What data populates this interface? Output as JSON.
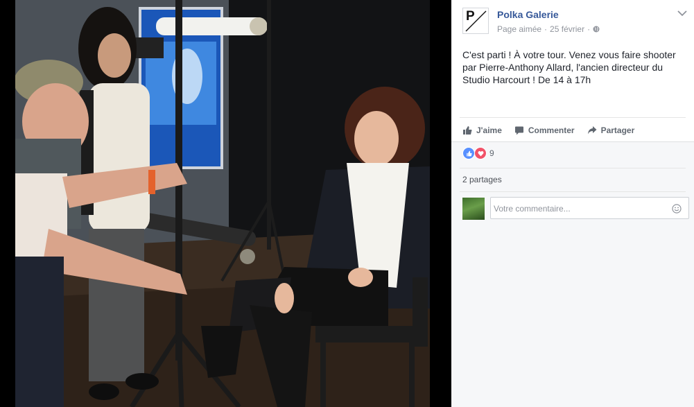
{
  "post": {
    "page_name": "Polka Galerie",
    "page_liked": "Page aimée",
    "separator": "·",
    "date": "25 février",
    "privacy_icon": "globe-icon",
    "options_icon": "chevron-down-icon",
    "logo_letter": "P",
    "text": "C'est parti ! À votre tour. Venez vous faire shooter par Pierre-Anthony Allard, l'ancien directeur du Studio Harcourt ! De 14 à 17h"
  },
  "actions": {
    "like_label": "J'aime",
    "comment_label": "Commenter",
    "share_label": "Partager"
  },
  "reactions": {
    "count": "9",
    "types": [
      "like",
      "love"
    ],
    "colors": {
      "like": "#5890ff",
      "love": "#f25268"
    }
  },
  "shares": {
    "label": "2 partages"
  },
  "comment": {
    "placeholder": "Votre commentaire..."
  },
  "colors": {
    "link": "#365899",
    "meta": "#90949c",
    "background": "#f6f7f9"
  }
}
